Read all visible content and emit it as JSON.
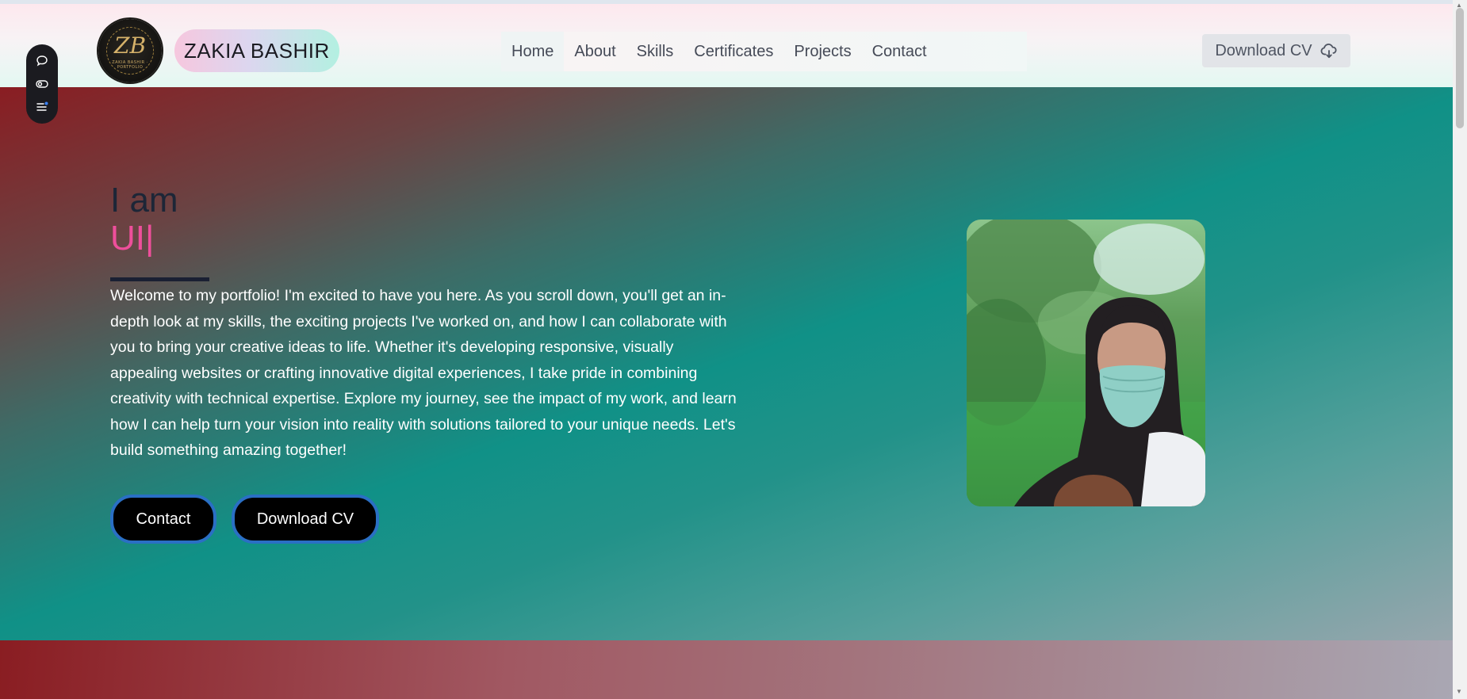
{
  "brand": {
    "logo_monogram": "ZB",
    "logo_subtitle": "ZAKIA BASHIR · PORTFOLIO",
    "name": "ZAKIA BASHIR"
  },
  "nav": {
    "items": [
      {
        "label": "Home"
      },
      {
        "label": "About"
      },
      {
        "label": "Skills"
      },
      {
        "label": "Certificates"
      },
      {
        "label": "Projects"
      },
      {
        "label": "Contact"
      }
    ],
    "download_cv": "Download CV"
  },
  "side_dock": {
    "icons": [
      "chat-bubble-icon",
      "toggle-view-icon",
      "menu-notification-icon"
    ]
  },
  "hero": {
    "greeting": "I am",
    "role_typed": "UI|",
    "intro": "Welcome to my portfolio! I'm excited to have you here. As you scroll down, you'll get an in-depth look at my skills, the exciting projects I've worked on, and how I can collaborate with you to bring your creative ideas to life. Whether it's developing responsive, visually appealing websites or crafting innovative digital experiences, I take pride in combining creativity with technical expertise. Explore my journey, see the impact of my work, and learn how I can help turn your vision into reality with solutions tailored to your unique needs. Let's build something amazing together!",
    "buttons": {
      "contact": "Contact",
      "download_cv": "Download CV"
    }
  },
  "colors": {
    "accent_pink": "#ee4f9b",
    "button_border": "#2a6fc4",
    "teal": "#109187",
    "maroon": "#8a1d22"
  }
}
